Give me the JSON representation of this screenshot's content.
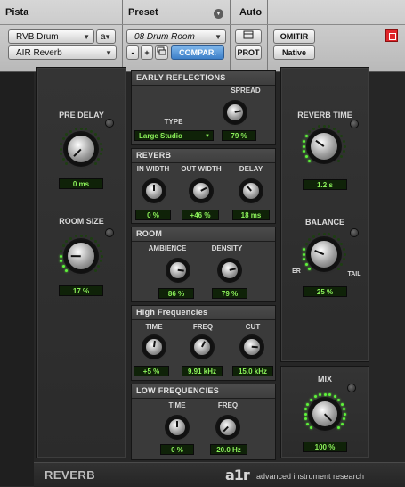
{
  "header": {
    "track_label": "Pista",
    "preset_label": "Preset",
    "auto_label": "Auto",
    "track_name": "RVB Drum",
    "track_channel": "a",
    "plugin_name": "AIR Reverb",
    "preset_name": "08 Drum Room",
    "minus": "-",
    "plus": "+",
    "compare": "COMPAR.",
    "prot": "PROT",
    "omitir": "OMITIR",
    "native": "Native"
  },
  "controls": {
    "pre_delay": {
      "label": "PRE DELAY",
      "value": "0 ms",
      "level": 0.0
    },
    "room_size": {
      "label": "ROOM SIZE",
      "value": "17 %",
      "level": 0.17
    },
    "reverb_time": {
      "label": "REVERB TIME",
      "value": "1.2 s",
      "level": 0.3
    },
    "balance": {
      "label": "BALANCE",
      "value": "25 %",
      "level": 0.25,
      "left": "ER",
      "right": "TAIL"
    },
    "mix": {
      "label": "MIX",
      "value": "100 %",
      "level": 1.0
    }
  },
  "early_reflections": {
    "title": "EARLY REFLECTIONS",
    "type_label": "TYPE",
    "type_value": "Large Studio",
    "spread": {
      "label": "SPREAD",
      "value": "79 %",
      "level": 0.79
    }
  },
  "reverb": {
    "title": "REVERB",
    "in_width": {
      "label": "IN WIDTH",
      "value": "0 %",
      "level": 0.5
    },
    "out_width": {
      "label": "OUT WIDTH",
      "value": "+46 %",
      "level": 0.73
    },
    "delay": {
      "label": "DELAY",
      "value": "18 ms",
      "level": 0.35
    }
  },
  "room": {
    "title": "ROOM",
    "ambience": {
      "label": "AMBIENCE",
      "value": "86 %",
      "level": 0.86
    },
    "density": {
      "label": "DENSITY",
      "value": "79 %",
      "level": 0.79
    }
  },
  "high_frequencies": {
    "title": "High Frequencies",
    "time": {
      "label": "TIME",
      "value": "+5 %",
      "level": 0.53
    },
    "freq": {
      "label": "FREQ",
      "value": "9.91 kHz",
      "level": 0.6
    },
    "cut": {
      "label": "CUT",
      "value": "15.0 kHz",
      "level": 0.85
    }
  },
  "low_frequencies": {
    "title": "LOW FREQUENCIES",
    "time": {
      "label": "TIME",
      "value": "0 %",
      "level": 0.5
    },
    "freq": {
      "label": "FREQ",
      "value": "20.0 Hz",
      "level": 0.0
    }
  },
  "footer": {
    "plugin_title": "REVERB",
    "brand_logo": "a1r",
    "brand_text": "advanced instrument research"
  },
  "colors": {
    "led_on": "#5ef23a",
    "value_text": "#8cf25a",
    "close": "#e0262b"
  }
}
